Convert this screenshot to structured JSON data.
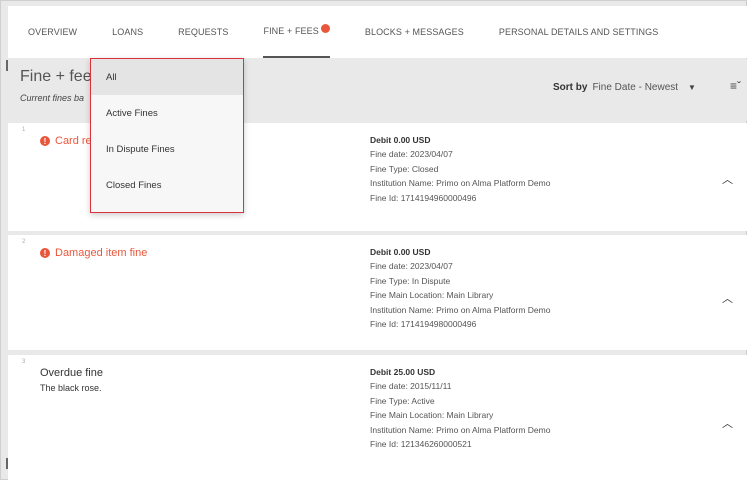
{
  "tabs": [
    {
      "label": "OVERVIEW"
    },
    {
      "label": "LOANS"
    },
    {
      "label": "REQUESTS"
    },
    {
      "label": "FINE + FEES"
    },
    {
      "label": "BLOCKS + MESSAGES"
    },
    {
      "label": "PERSONAL DETAILS AND SETTINGS"
    }
  ],
  "page": {
    "title": "Fine + fees",
    "subtitle": "Current fines ba"
  },
  "sort": {
    "label": "Sort by",
    "value": "Fine Date - Newest"
  },
  "dropdown": {
    "options": [
      "All",
      "Active Fines",
      "In Dispute Fines",
      "Closed Fines"
    ]
  },
  "fines": [
    {
      "number": "1",
      "title": "Card re",
      "amount": "Debit 0.00 USD",
      "date": "Fine date: 2023/04/07",
      "type": "Fine Type: Closed",
      "institution": "Institution Name: Primo on Alma Platform Demo",
      "id": "Fine Id: 1714194960000496"
    },
    {
      "number": "2",
      "title": "Damaged item fine",
      "amount": "Debit 0.00 USD",
      "date": "Fine date: 2023/04/07",
      "type": "Fine Type: In Dispute",
      "location": "Fine Main Location: Main Library",
      "institution": "Institution Name: Primo on Alma Platform Demo",
      "id": "Fine Id: 1714194980000496"
    },
    {
      "number": "3",
      "title": "Overdue fine",
      "subtitle": "The black rose.",
      "amount": "Debit 25.00 USD",
      "date": "Fine date: 2015/11/11",
      "type": "Fine Type: Active",
      "location": "Fine Main Location: Main Library",
      "institution": "Institution Name: Primo on Alma Platform Demo",
      "id": "Fine Id: 121346260000521"
    }
  ],
  "colors": {
    "accent": "#e8573c",
    "highlight_border": "#d8333a"
  },
  "icons": {
    "alert": "alert-circle-icon",
    "expand": "chevron-up-icon",
    "sort": "sort-order-icon",
    "caret": "caret-down-icon"
  }
}
